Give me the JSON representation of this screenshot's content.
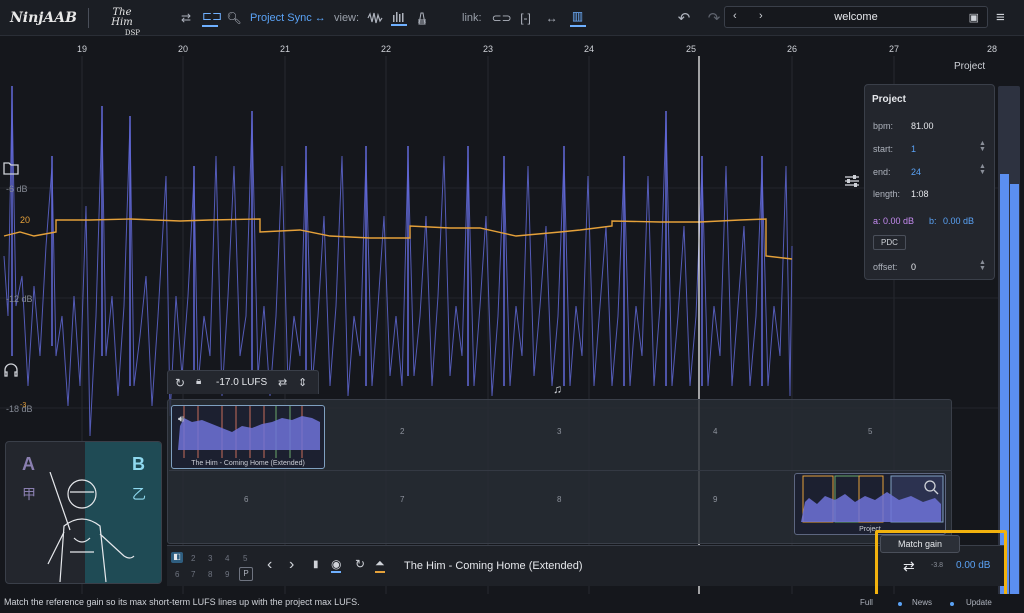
{
  "brand": {
    "logo": "NinjAAB",
    "partner_line1": "The Him",
    "partner_line2": "DSP"
  },
  "toolbar": {
    "sync_label": "Project Sync ↔",
    "view_label": "view:",
    "link_label": "link:",
    "nav_title": "welcome"
  },
  "ruler": {
    "bars": [
      "19",
      "20",
      "21",
      "22",
      "23",
      "24",
      "25",
      "26",
      "27",
      "28"
    ],
    "end_label": "Project"
  },
  "y_axis": {
    "labels": [
      "-6 dB",
      "20",
      "-12 dB",
      "-18 dB",
      "-3"
    ]
  },
  "project_panel": {
    "title": "Project",
    "bpm_label": "bpm:",
    "bpm": "81.00",
    "start_label": "start:",
    "start": "1",
    "end_label": "end:",
    "end": "24",
    "length_label": "length:",
    "length": "1:08",
    "a_label": "a:",
    "a_value": "0.00 dB",
    "b_label": "b:",
    "b_value": "0.00 dB",
    "pdc_label": "PDC",
    "offset_label": "offset:",
    "offset": "0"
  },
  "reference_toolbar": {
    "lufs": "-17.0 LUFS"
  },
  "slots": {
    "numbers": [
      "2",
      "3",
      "4",
      "5",
      "6",
      "7",
      "8",
      "9"
    ],
    "reference_name": "The Him - Coming Home (Extended)",
    "project_thumb_label": "Project"
  },
  "ab_box": {
    "a": "A",
    "b": "B",
    "a_cjk": "甲",
    "b_cjk": "乙"
  },
  "transport": {
    "slot_nums_top": [
      "1",
      "2",
      "3",
      "4",
      "5"
    ],
    "slot_nums_bottom": [
      "6",
      "7",
      "8",
      "9"
    ],
    "p_label": "P",
    "track_name": "The Him - Coming Home (Extended)",
    "gain_offset": "-3.8",
    "gain_value": "0.00 dB"
  },
  "match_gain": {
    "tooltip": "Match gain"
  },
  "status": {
    "message": "Match the reference gain so its max short-term LUFS lines up with the project max LUFS.",
    "full": "Full",
    "news": "News",
    "update": "Update"
  },
  "colors": {
    "accent": "#5aa2f5",
    "loudness": "#e5a13a",
    "waveform": "#5b63c9",
    "highlight": "#f2b20e"
  }
}
